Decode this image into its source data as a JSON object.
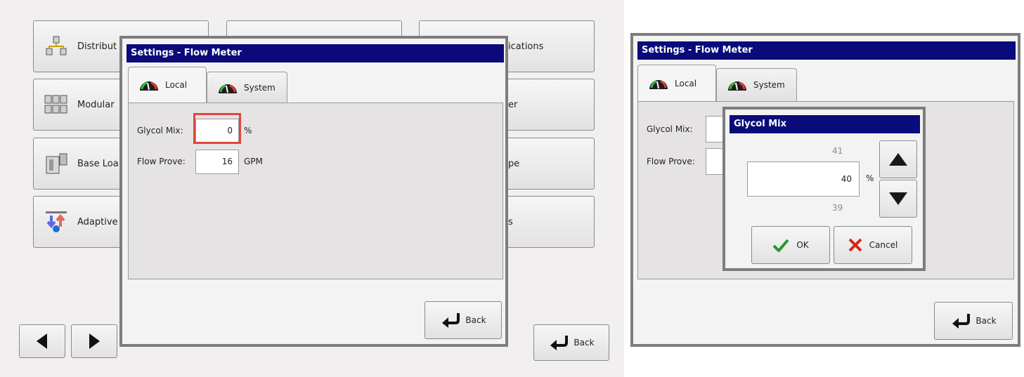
{
  "main_menu": {
    "items": [
      {
        "label": "Distribut"
      },
      {
        "label": "Modular"
      },
      {
        "label": "Base Loa"
      },
      {
        "label": "Adaptive"
      }
    ],
    "right_items": [
      {
        "label": "ications"
      },
      {
        "label": "er"
      },
      {
        "label": "pe"
      },
      {
        "label": "s"
      }
    ],
    "back_label": "Back"
  },
  "dialog_left": {
    "title": "Settings - Flow Meter",
    "tabs": [
      {
        "label": "Local"
      },
      {
        "label": "System"
      }
    ],
    "fields": [
      {
        "label": "Glycol Mix:",
        "value": "0",
        "unit": "%"
      },
      {
        "label": "Flow Prove:",
        "value": "16",
        "unit": "GPM"
      }
    ],
    "back_label": "Back"
  },
  "dialog_right": {
    "title": "Settings - Flow Meter",
    "tabs": [
      {
        "label": "Local"
      },
      {
        "label": "System"
      }
    ],
    "fields": [
      {
        "label": "Glycol Mix:"
      },
      {
        "label": "Flow Prove:"
      }
    ],
    "back_label": "Back"
  },
  "glycol_popup": {
    "title": "Glycol Mix",
    "next_value": "41",
    "value": "40",
    "unit": "%",
    "prev_value": "39",
    "ok_label": "OK",
    "cancel_label": "Cancel"
  },
  "colors": {
    "titlebar": "#0a0a7a",
    "highlight": "#e0463c",
    "ok_check": "#1f9a2a",
    "cancel_x": "#d4281c"
  }
}
